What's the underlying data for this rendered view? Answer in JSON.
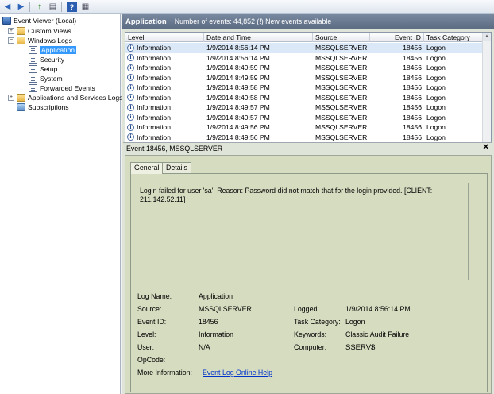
{
  "tree": {
    "root": "Event Viewer (Local)",
    "custom_views": "Custom Views",
    "windows_logs": "Windows Logs",
    "logs": [
      "Application",
      "Security",
      "Setup",
      "System",
      "Forwarded Events"
    ],
    "apps_services": "Applications and Services Logs",
    "subscriptions": "Subscriptions",
    "expander_plus": "+",
    "expander_minus": "−"
  },
  "header": {
    "title": "Application",
    "count": "Number of events: 44,852 (!) New events available"
  },
  "grid": {
    "columns": [
      "Level",
      "Date and Time",
      "Source",
      "Event ID",
      "Task Category"
    ],
    "rows": [
      {
        "level": "Information",
        "datetime": "1/9/2014 8:56:14 PM",
        "source": "MSSQLSERVER",
        "id": "18456",
        "cat": "Logon"
      },
      {
        "level": "Information",
        "datetime": "1/9/2014 8:56:14 PM",
        "source": "MSSQLSERVER",
        "id": "18456",
        "cat": "Logon"
      },
      {
        "level": "Information",
        "datetime": "1/9/2014 8:49:59 PM",
        "source": "MSSQLSERVER",
        "id": "18456",
        "cat": "Logon"
      },
      {
        "level": "Information",
        "datetime": "1/9/2014 8:49:59 PM",
        "source": "MSSQLSERVER",
        "id": "18456",
        "cat": "Logon"
      },
      {
        "level": "Information",
        "datetime": "1/9/2014 8:49:58 PM",
        "source": "MSSQLSERVER",
        "id": "18456",
        "cat": "Logon"
      },
      {
        "level": "Information",
        "datetime": "1/9/2014 8:49:58 PM",
        "source": "MSSQLSERVER",
        "id": "18456",
        "cat": "Logon"
      },
      {
        "level": "Information",
        "datetime": "1/9/2014 8:49:57 PM",
        "source": "MSSQLSERVER",
        "id": "18456",
        "cat": "Logon"
      },
      {
        "level": "Information",
        "datetime": "1/9/2014 8:49:57 PM",
        "source": "MSSQLSERVER",
        "id": "18456",
        "cat": "Logon"
      },
      {
        "level": "Information",
        "datetime": "1/9/2014 8:49:56 PM",
        "source": "MSSQLSERVER",
        "id": "18456",
        "cat": "Logon"
      },
      {
        "level": "Information",
        "datetime": "1/9/2014 8:49:56 PM",
        "source": "MSSQLSERVER",
        "id": "18456",
        "cat": "Logon"
      }
    ],
    "info_glyph": "i",
    "scroll_up": "▲",
    "scroll_down": "▼"
  },
  "detail": {
    "title": "Event 18456, MSSQLSERVER",
    "close": "✕",
    "tabs": [
      "General",
      "Details"
    ],
    "message": "Login failed for user 'sa'. Reason: Password did not match that for the login provided. [CLIENT: 211.142.52.11]",
    "labels": {
      "log_name": "Log Name:",
      "source": "Source:",
      "event_id": "Event ID:",
      "level": "Level:",
      "user": "User:",
      "opcode": "OpCode:",
      "more_info": "More Information:",
      "logged": "Logged:",
      "task_category": "Task Category:",
      "keywords": "Keywords:",
      "computer": "Computer:"
    },
    "values": {
      "log_name": "Application",
      "source": "MSSQLSERVER",
      "event_id": "18456",
      "level": "Information",
      "user": "N/A",
      "more_info_link": "Event Log Online Help",
      "logged": "1/9/2014 8:56:14 PM",
      "task_category": "Logon",
      "keywords": "Classic,Audit Failure",
      "computer": "SSERV$"
    }
  },
  "toolbar": {
    "back_icon": "◀",
    "forward_icon": "▶",
    "up_icon": "↑",
    "console_icon": "▤",
    "help_icon": "?",
    "view_icon": "▦"
  }
}
